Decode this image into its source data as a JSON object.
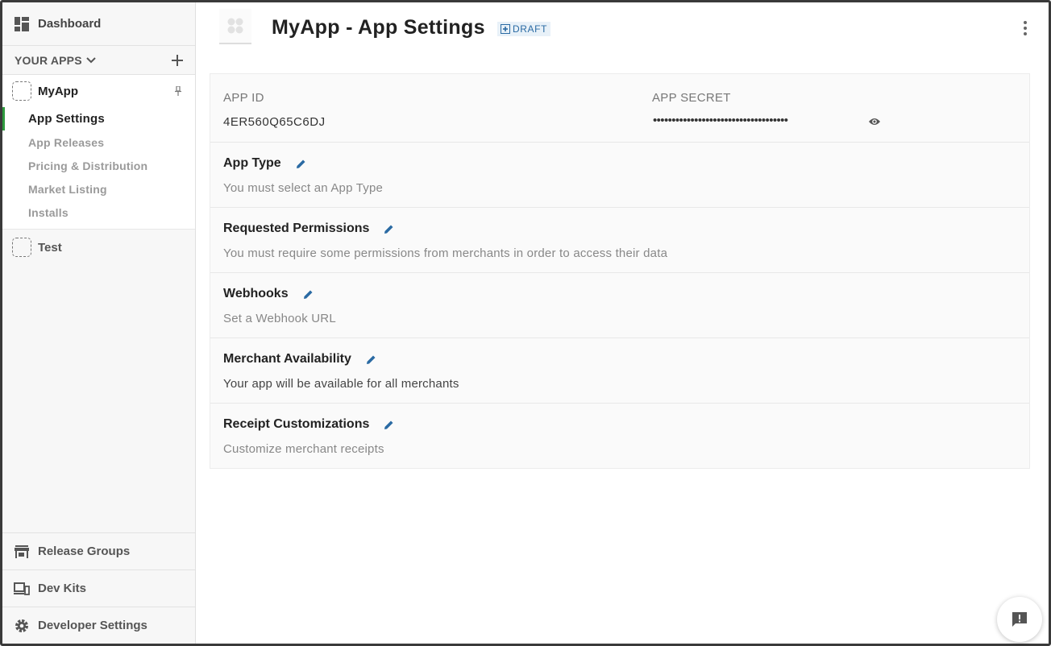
{
  "sidebar": {
    "dashboard_label": "Dashboard",
    "your_apps_label": "YOUR APPS",
    "apps": [
      {
        "name": "MyApp",
        "items": [
          {
            "label": "App Settings",
            "active": true
          },
          {
            "label": "App Releases"
          },
          {
            "label": "Pricing & Distribution"
          },
          {
            "label": "Market Listing"
          },
          {
            "label": "Installs"
          }
        ]
      },
      {
        "name": "Test"
      }
    ],
    "bottom": {
      "release_groups": "Release Groups",
      "dev_kits": "Dev Kits",
      "developer_settings": "Developer Settings"
    }
  },
  "header": {
    "title": "MyApp - App Settings",
    "badge": "DRAFT"
  },
  "keys": {
    "app_id_label": "APP ID",
    "app_id_value": "4ER560Q65C6DJ",
    "app_secret_label": "APP SECRET",
    "app_secret_masked": "••••••••••••••••••••••••••••••••••••"
  },
  "sections": [
    {
      "title": "App Type",
      "desc": "You must select an App Type"
    },
    {
      "title": "Requested Permissions",
      "desc": "You must require some permissions from merchants in order to access their data"
    },
    {
      "title": "Webhooks",
      "desc": "Set a Webhook URL"
    },
    {
      "title": "Merchant Availability",
      "desc": "Your app will be available for all merchants"
    },
    {
      "title": "Receipt Customizations",
      "desc": "Customize merchant receipts"
    }
  ],
  "colors": {
    "accent_green": "#2e9a3e",
    "edit_blue": "#2a6aa3",
    "badge_bg": "#e8f1f8"
  }
}
